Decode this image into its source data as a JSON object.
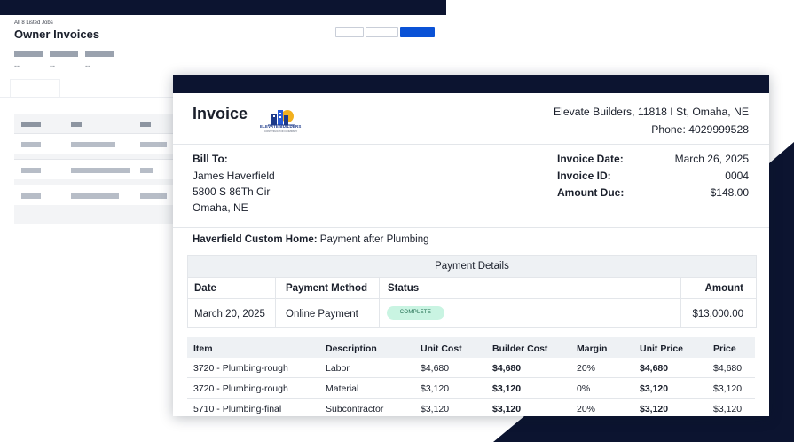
{
  "background_app": {
    "breadcrumb": "All 8 Listed Jobs",
    "title": "Owner Invoices",
    "stats": [
      {
        "value": "--"
      },
      {
        "value": "--"
      },
      {
        "value": "--"
      }
    ]
  },
  "invoice": {
    "title": "Invoice",
    "logo": {
      "text": "ELEVATE BUILDERS",
      "subtext": "CONSTRUCTION COMPANY"
    },
    "company_address": "Elevate Builders, 11818 I St, Omaha, NE",
    "company_phone": "Phone: 4029999528",
    "bill_to": {
      "label": "Bill To:",
      "name": "James Haverfield",
      "street": "5800 S 86Th Cir",
      "city": "Omaha, NE"
    },
    "meta": {
      "date_label": "Invoice Date:",
      "date_value": "March 26, 2025",
      "id_label": "Invoice ID:",
      "id_value": "0004",
      "amount_label": "Amount Due:",
      "amount_value": "$148.00"
    },
    "project": {
      "name": "Haverfield Custom Home:",
      "description": "Payment after Plumbing"
    },
    "payment_details": {
      "heading": "Payment Details",
      "columns": {
        "date": "Date",
        "method": "Payment Method",
        "status": "Status",
        "amount": "Amount"
      },
      "row": {
        "date": "March 20, 2025",
        "method": "Online Payment",
        "status": "COMPLETE",
        "amount": "$13,000.00"
      }
    },
    "items_table": {
      "columns": {
        "item": "Item",
        "description": "Description",
        "unit_cost": "Unit Cost",
        "builder_cost": "Builder Cost",
        "margin": "Margin",
        "unit_price": "Unit Price",
        "price": "Price"
      },
      "rows": [
        {
          "item": "3720 - Plumbing-rough",
          "description": "Labor",
          "unit_cost": "$4,680",
          "builder_cost": "$4,680",
          "margin": "20%",
          "unit_price": "$4,680",
          "price": "$4,680"
        },
        {
          "item": "3720 - Plumbing-rough",
          "description": "Material",
          "unit_cost": "$3,120",
          "builder_cost": "$3,120",
          "margin": "0%",
          "unit_price": "$3,120",
          "price": "$3,120"
        },
        {
          "item": "5710 - Plumbing-final",
          "description": "Subcontractor",
          "unit_cost": "$3,120",
          "builder_cost": "$3,120",
          "margin": "20%",
          "unit_price": "$3,120",
          "price": "$3,120"
        }
      ]
    }
  },
  "colors": {
    "navy": "#0c1430",
    "primary_button": "#0a52d6",
    "complete_badge_bg": "#c9f4e2",
    "header_fill": "#eef1f4"
  }
}
